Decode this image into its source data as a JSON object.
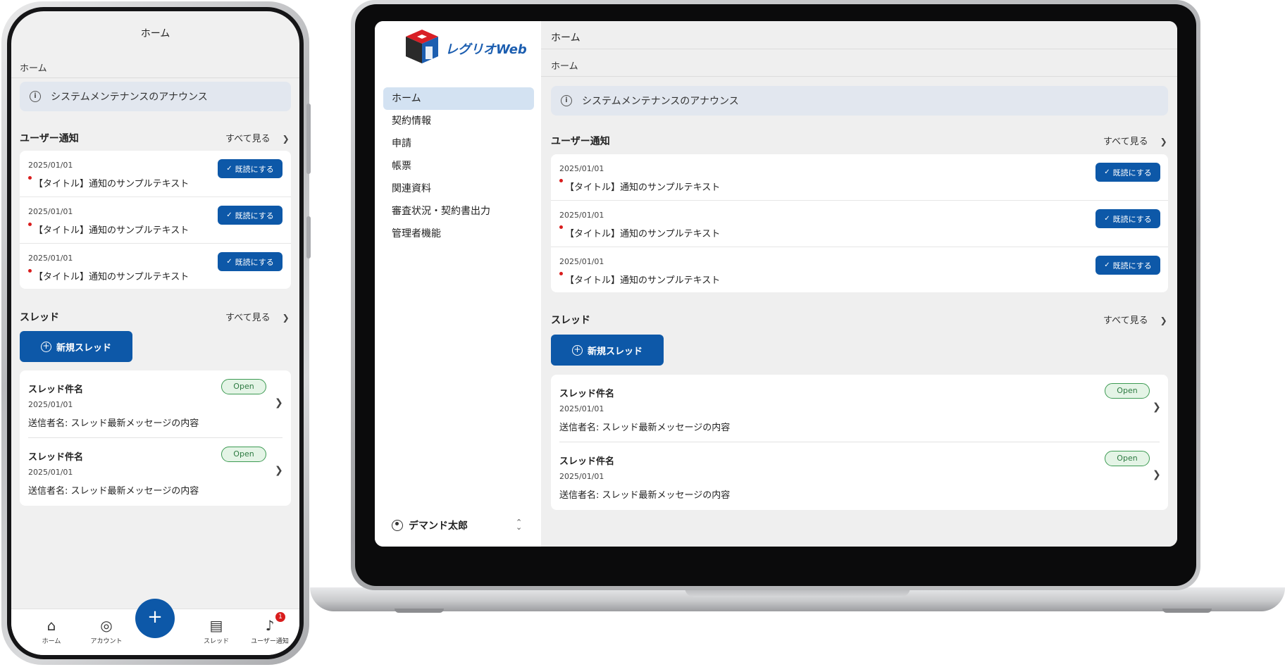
{
  "phone": {
    "header_title": "ホーム",
    "breadcrumb": "ホーム",
    "announcement": "システムメンテナンスのアナウンス",
    "notifications_title": "ユーザー通知",
    "see_all": "すべて見る",
    "notifications": [
      {
        "date": "2025/01/01",
        "text": "【タイトル】通知のサンプルテキスト",
        "button": "既読にする"
      },
      {
        "date": "2025/01/01",
        "text": "【タイトル】通知のサンプルテキスト",
        "button": "既読にする"
      },
      {
        "date": "2025/01/01",
        "text": "【タイトル】通知のサンプルテキスト",
        "button": "既読にする"
      }
    ],
    "threads_title": "スレッド",
    "new_thread": "新規スレッド",
    "threads": [
      {
        "title": "スレッド件名",
        "date": "2025/01/01",
        "message": "送信者名: スレッド最新メッセージの内容",
        "status": "Open"
      },
      {
        "title": "スレッド件名",
        "date": "2025/01/01",
        "message": "送信者名: スレッド最新メッセージの内容",
        "status": "Open"
      }
    ],
    "bottom_nav": [
      {
        "label": "ホーム",
        "icon": "home-icon"
      },
      {
        "label": "アカウント",
        "icon": "account-icon"
      },
      {
        "label": "スレッド",
        "icon": "thread-icon"
      },
      {
        "label": "ユーザー通知",
        "icon": "bell-icon",
        "badge": "1"
      }
    ],
    "fab_icon": "plus-icon"
  },
  "laptop": {
    "logo_text": "レグリオWeb",
    "nav": [
      {
        "label": "ホーム",
        "active": true
      },
      {
        "label": "契約情報"
      },
      {
        "label": "申請"
      },
      {
        "label": "帳票"
      },
      {
        "label": "関連資料"
      },
      {
        "label": "審査状況・契約書出力"
      },
      {
        "label": "管理者機能"
      }
    ],
    "user_name": "デマンド太郎",
    "header_title": "ホーム",
    "breadcrumb": "ホーム",
    "announcement": "システムメンテナンスのアナウンス",
    "notifications_title": "ユーザー通知",
    "see_all": "すべて見る",
    "notifications": [
      {
        "date": "2025/01/01",
        "text": "【タイトル】通知のサンプルテキスト",
        "button": "既読にする"
      },
      {
        "date": "2025/01/01",
        "text": "【タイトル】通知のサンプルテキスト",
        "button": "既読にする"
      },
      {
        "date": "2025/01/01",
        "text": "【タイトル】通知のサンプルテキスト",
        "button": "既読にする"
      }
    ],
    "threads_title": "スレッド",
    "new_thread": "新規スレッド",
    "threads": [
      {
        "title": "スレッド件名",
        "date": "2025/01/01",
        "message": "送信者名: スレッド最新メッセージの内容",
        "status": "Open"
      },
      {
        "title": "スレッド件名",
        "date": "2025/01/01",
        "message": "送信者名: スレッド最新メッセージの内容",
        "status": "Open"
      }
    ]
  },
  "colors": {
    "primary": "#0d58a8",
    "active_nav": "#d3e2f2",
    "announcement_bg": "#e2e7ef",
    "unread_dot": "#d91d1d",
    "open_badge": "#3c9a52"
  }
}
